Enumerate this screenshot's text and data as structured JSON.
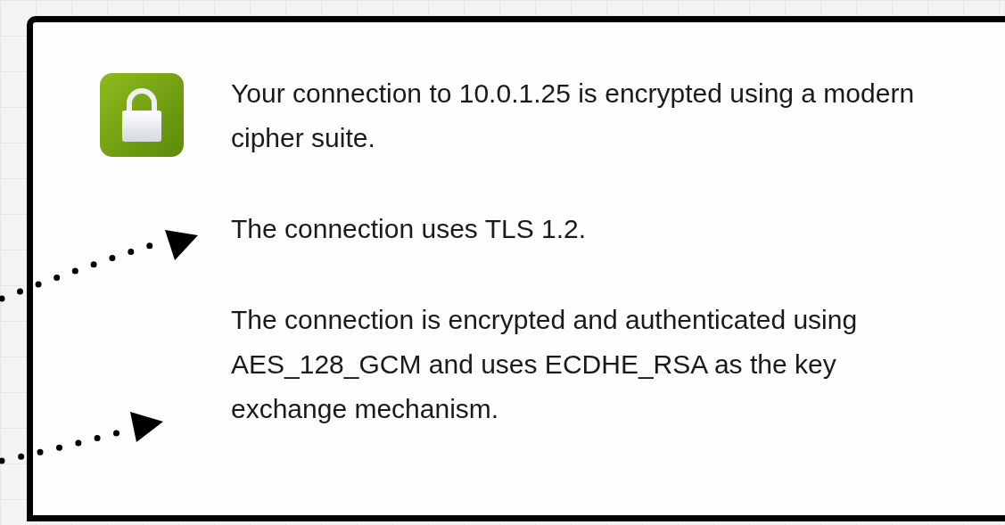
{
  "security_popup": {
    "paragraphs": [
      "Your connection to 10.0.1.25 is encrypted using a modern cipher suite.",
      "The connection uses TLS 1.2.",
      "The connection is encrypted and authenticated using AES_128_GCM and uses ECDHE_RSA as the key exchange mechanism."
    ]
  }
}
